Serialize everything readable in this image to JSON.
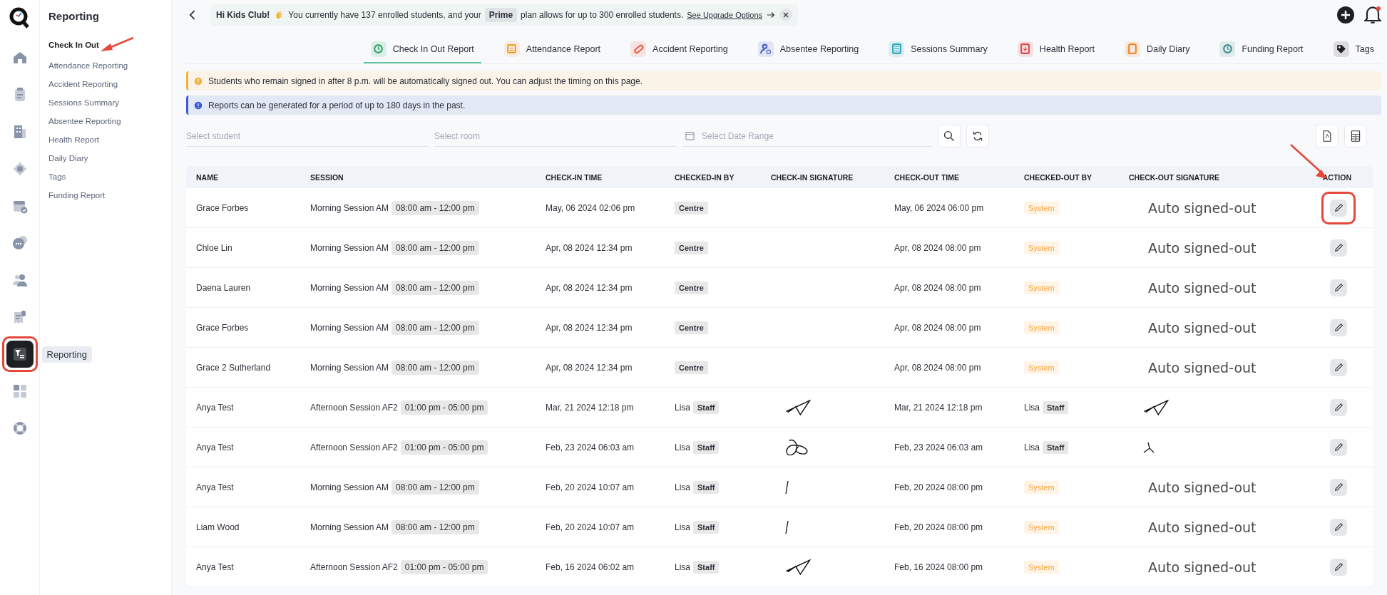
{
  "rail": {
    "items": [
      {
        "kind": "home",
        "selected": false,
        "highlighted": false
      },
      {
        "kind": "clipboard",
        "selected": false,
        "highlighted": false
      },
      {
        "kind": "building",
        "selected": false,
        "highlighted": false
      },
      {
        "kind": "gear",
        "selected": false,
        "highlighted": false
      },
      {
        "kind": "calendar",
        "selected": false,
        "highlighted": false
      },
      {
        "kind": "chat",
        "selected": false,
        "highlighted": false
      },
      {
        "kind": "people",
        "selected": false,
        "highlighted": false
      },
      {
        "kind": "receipt",
        "selected": false,
        "highlighted": false
      },
      {
        "kind": "report",
        "selected": true,
        "highlighted": true,
        "tooltip": "Reporting"
      },
      {
        "kind": "grid",
        "selected": false,
        "highlighted": false
      },
      {
        "kind": "lifebuoy",
        "selected": false,
        "highlighted": false
      }
    ]
  },
  "sidebar": {
    "title": "Reporting",
    "items": [
      {
        "label": "Check In Out",
        "selected": true,
        "arrow": true
      },
      {
        "label": "Attendance Reporting",
        "selected": false,
        "arrow": false
      },
      {
        "label": "Accident Reporting",
        "selected": false,
        "arrow": false
      },
      {
        "label": "Sessions Summary",
        "selected": false,
        "arrow": false
      },
      {
        "label": "Absentee Reporting",
        "selected": false,
        "arrow": false
      },
      {
        "label": "Health Report",
        "selected": false,
        "arrow": false
      },
      {
        "label": "Daily Diary",
        "selected": false,
        "arrow": false
      },
      {
        "label": "Tags",
        "selected": false,
        "arrow": false
      },
      {
        "label": "Funding Report",
        "selected": false,
        "arrow": false
      }
    ]
  },
  "banner": {
    "greeting": "Hi Kids Club!",
    "message": "You currently have 137 enrolled students, and your",
    "plan": "Prime",
    "message_end": "plan allows for up to 300 enrolled students.",
    "link": "See Upgrade Options"
  },
  "tabs": [
    {
      "label": "Check In Out Report",
      "selected": true,
      "color": "#2fa36b"
    },
    {
      "label": "Attendance Report",
      "selected": false,
      "color": "#f0a030"
    },
    {
      "label": "Accident Reporting",
      "selected": false,
      "color": "#e8604c"
    },
    {
      "label": "Absentee Reporting",
      "selected": false,
      "color": "#4a5fc1"
    },
    {
      "label": "Sessions Summary",
      "selected": false,
      "color": "#2aa8b8"
    },
    {
      "label": "Health Report",
      "selected": false,
      "color": "#e04848"
    },
    {
      "label": "Daily Diary",
      "selected": false,
      "color": "#f08a2a"
    },
    {
      "label": "Funding Report",
      "selected": false,
      "color": "#3a8f8f"
    },
    {
      "label": "Tags",
      "selected": false,
      "color": "#222222"
    }
  ],
  "alerts": [
    {
      "kind": "warning",
      "text": "Students who remain signed in after 8 p.m. will be automatically signed out. You can adjust the timing on this page."
    },
    {
      "kind": "info",
      "text": "Reports can be generated for a period of up to 180 days in the past."
    }
  ],
  "filters": {
    "student": {
      "placeholder": "Select student"
    },
    "room": {
      "placeholder": "Select room"
    },
    "date": {
      "placeholder": "Select Date Range"
    }
  },
  "table": {
    "columns": [
      {
        "label": "NAME",
        "arrow": false
      },
      {
        "label": "SESSION",
        "arrow": false
      },
      {
        "label": "CHECK-IN TIME",
        "arrow": false
      },
      {
        "label": "CHECKED-IN BY",
        "arrow": false
      },
      {
        "label": "CHECK-IN SIGNATURE",
        "arrow": false
      },
      {
        "label": "CHECK-OUT TIME",
        "arrow": false
      },
      {
        "label": "CHECKED-OUT BY",
        "arrow": false
      },
      {
        "label": "CHECK-OUT SIGNATURE",
        "arrow": false
      },
      {
        "label": "ACTION",
        "arrow": true
      }
    ],
    "rows": [
      {
        "name": "Grace Forbes",
        "session": "Morning Session AM",
        "session_time": "08:00 am - 12:00 pm",
        "check_in_time": "May, 06 2024 02:06 pm",
        "checked_in_by": {
          "kind": "centre",
          "role": "Centre"
        },
        "check_out_time": "May, 06 2024 06:00 pm",
        "checked_out_by": {
          "kind": "system",
          "role": "System"
        },
        "check_out_signature": {
          "kind": "text",
          "text": "Auto signed-out"
        },
        "action_highlighted": true
      },
      {
        "name": "Chloe Lin",
        "session": "Morning Session AM",
        "session_time": "08:00 am - 12:00 pm",
        "check_in_time": "Apr, 08 2024 12:34 pm",
        "checked_in_by": {
          "kind": "centre",
          "role": "Centre"
        },
        "check_out_time": "Apr, 08 2024 08:00 pm",
        "checked_out_by": {
          "kind": "system",
          "role": "System"
        },
        "check_out_signature": {
          "kind": "text",
          "text": "Auto signed-out"
        },
        "action_highlighted": false
      },
      {
        "name": "Daena Lauren",
        "session": "Morning Session AM",
        "session_time": "08:00 am - 12:00 pm",
        "check_in_time": "Apr, 08 2024 12:34 pm",
        "checked_in_by": {
          "kind": "centre",
          "role": "Centre"
        },
        "check_out_time": "Apr, 08 2024 08:00 pm",
        "checked_out_by": {
          "kind": "system",
          "role": "System"
        },
        "check_out_signature": {
          "kind": "text",
          "text": "Auto signed-out"
        },
        "action_highlighted": false
      },
      {
        "name": "Grace Forbes",
        "session": "Morning Session AM",
        "session_time": "08:00 am - 12:00 pm",
        "check_in_time": "Apr, 08 2024 12:34 pm",
        "checked_in_by": {
          "kind": "centre",
          "role": "Centre"
        },
        "check_out_time": "Apr, 08 2024 08:00 pm",
        "checked_out_by": {
          "kind": "system",
          "role": "System"
        },
        "check_out_signature": {
          "kind": "text",
          "text": "Auto signed-out"
        },
        "action_highlighted": false
      },
      {
        "name": "Grace 2 Sutherland",
        "session": "Morning Session AM",
        "session_time": "08:00 am - 12:00 pm",
        "check_in_time": "Apr, 08 2024 12:34 pm",
        "checked_in_by": {
          "kind": "centre",
          "role": "Centre"
        },
        "check_out_time": "Apr, 08 2024 08:00 pm",
        "checked_out_by": {
          "kind": "system",
          "role": "System"
        },
        "check_out_signature": {
          "kind": "text",
          "text": "Auto signed-out"
        },
        "action_highlighted": false
      },
      {
        "name": "Anya Test",
        "session": "Afternoon Session AF2",
        "session_time": "01:00 pm - 05:00 pm",
        "check_in_time": "Mar, 21 2024 12:18 pm",
        "checked_in_by": {
          "kind": "staff",
          "name": "Lisa",
          "role": "Staff"
        },
        "check_in_signature": {
          "kind": "arrow"
        },
        "check_out_time": "Mar, 21 2024 12:18 pm",
        "checked_out_by": {
          "kind": "staff",
          "name": "Lisa",
          "role": "Staff"
        },
        "check_out_signature": {
          "kind": "arrow"
        },
        "action_highlighted": false
      },
      {
        "name": "Anya Test",
        "session": "Afternoon Session AF2",
        "session_time": "01:00 pm - 05:00 pm",
        "check_in_time": "Feb, 23 2024 06:03 am",
        "checked_in_by": {
          "kind": "staff",
          "name": "Lisa",
          "role": "Staff"
        },
        "check_in_signature": {
          "kind": "loop"
        },
        "check_out_time": "Feb, 23 2024 06:03 am",
        "checked_out_by": {
          "kind": "staff",
          "name": "Lisa",
          "role": "Staff"
        },
        "check_out_signature": {
          "kind": "caret"
        },
        "action_highlighted": false
      },
      {
        "name": "Anya Test",
        "session": "Morning Session AM",
        "session_time": "08:00 am - 12:00 pm",
        "check_in_time": "Feb, 20 2024 10:07 am",
        "checked_in_by": {
          "kind": "staff",
          "name": "Lisa",
          "role": "Staff"
        },
        "check_in_signature": {
          "kind": "stroke"
        },
        "check_out_time": "Feb, 20 2024 08:00 pm",
        "checked_out_by": {
          "kind": "system",
          "role": "System"
        },
        "check_out_signature": {
          "kind": "text",
          "text": "Auto signed-out"
        },
        "action_highlighted": false
      },
      {
        "name": "Liam Wood",
        "session": "Morning Session AM",
        "session_time": "08:00 am - 12:00 pm",
        "check_in_time": "Feb, 20 2024 10:07 am",
        "checked_in_by": {
          "kind": "staff",
          "name": "Lisa",
          "role": "Staff"
        },
        "check_in_signature": {
          "kind": "stroke"
        },
        "check_out_time": "Feb, 20 2024 08:00 pm",
        "checked_out_by": {
          "kind": "system",
          "role": "System"
        },
        "check_out_signature": {
          "kind": "text",
          "text": "Auto signed-out"
        },
        "action_highlighted": false
      },
      {
        "name": "Anya Test",
        "session": "Afternoon Session AF2",
        "session_time": "01:00 pm - 05:00 pm",
        "check_in_time": "Feb, 16 2024 06:02 am",
        "checked_in_by": {
          "kind": "staff",
          "name": "Lisa",
          "role": "Staff"
        },
        "check_in_signature": {
          "kind": "arrow"
        },
        "check_out_time": "Feb, 16 2024 08:00 pm",
        "checked_out_by": {
          "kind": "system",
          "role": "System"
        },
        "check_out_signature": {
          "kind": "text",
          "text": "Auto signed-out"
        },
        "action_highlighted": false
      }
    ]
  }
}
